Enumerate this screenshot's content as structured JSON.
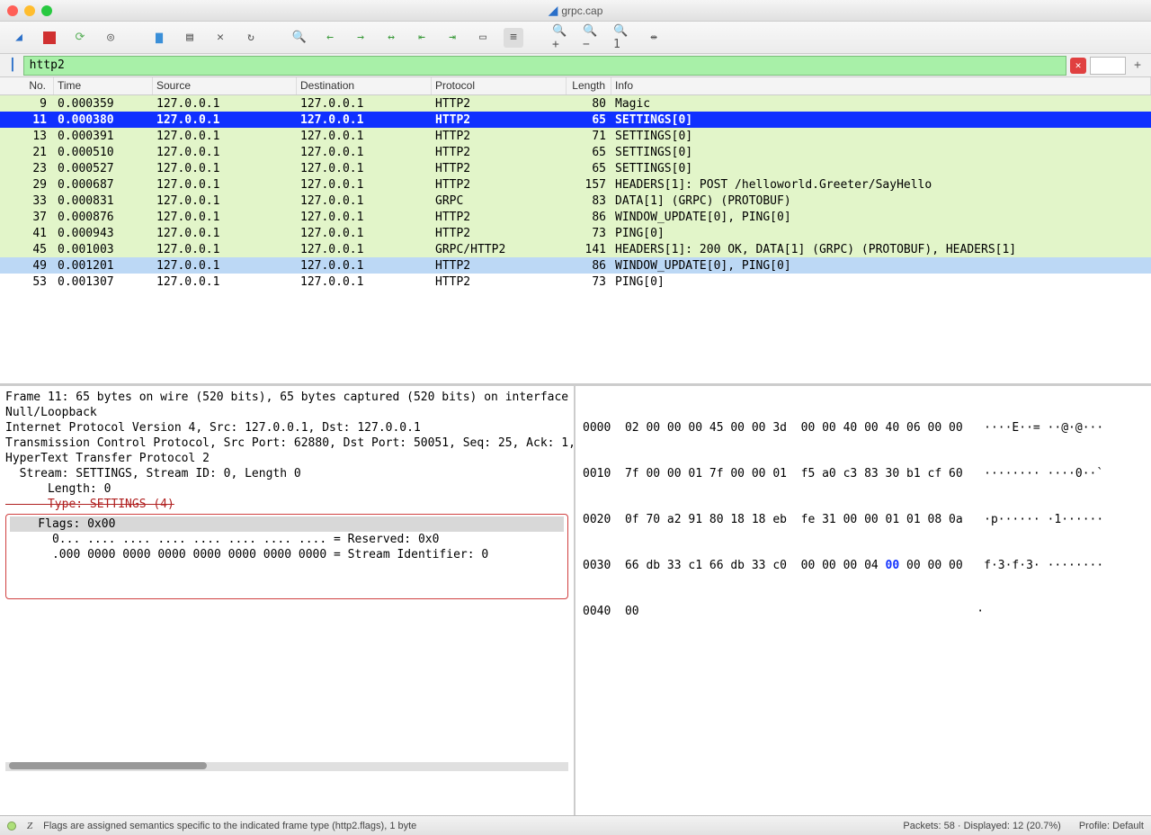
{
  "window": {
    "title": "grpc.cap"
  },
  "filter": {
    "value": "http2"
  },
  "columns": {
    "no": "No.",
    "time": "Time",
    "source": "Source",
    "destination": "Destination",
    "protocol": "Protocol",
    "length": "Length",
    "info": "Info"
  },
  "packets": [
    {
      "no": "9",
      "time": "0.000359",
      "src": "127.0.0.1",
      "dst": "127.0.0.1",
      "proto": "HTTP2",
      "len": "80",
      "info": "Magic",
      "cls": "green"
    },
    {
      "no": "11",
      "time": "0.000380",
      "src": "127.0.0.1",
      "dst": "127.0.0.1",
      "proto": "HTTP2",
      "len": "65",
      "info": "SETTINGS[0]",
      "cls": "selected-blue"
    },
    {
      "no": "13",
      "time": "0.000391",
      "src": "127.0.0.1",
      "dst": "127.0.0.1",
      "proto": "HTTP2",
      "len": "71",
      "info": "SETTINGS[0]",
      "cls": "green"
    },
    {
      "no": "21",
      "time": "0.000510",
      "src": "127.0.0.1",
      "dst": "127.0.0.1",
      "proto": "HTTP2",
      "len": "65",
      "info": "SETTINGS[0]",
      "cls": "green"
    },
    {
      "no": "23",
      "time": "0.000527",
      "src": "127.0.0.1",
      "dst": "127.0.0.1",
      "proto": "HTTP2",
      "len": "65",
      "info": "SETTINGS[0]",
      "cls": "green"
    },
    {
      "no": "29",
      "time": "0.000687",
      "src": "127.0.0.1",
      "dst": "127.0.0.1",
      "proto": "HTTP2",
      "len": "157",
      "info": "HEADERS[1]: POST /helloworld.Greeter/SayHello",
      "cls": "green"
    },
    {
      "no": "33",
      "time": "0.000831",
      "src": "127.0.0.1",
      "dst": "127.0.0.1",
      "proto": "GRPC",
      "len": "83",
      "info": "DATA[1] (GRPC) (PROTOBUF)",
      "cls": "green"
    },
    {
      "no": "37",
      "time": "0.000876",
      "src": "127.0.0.1",
      "dst": "127.0.0.1",
      "proto": "HTTP2",
      "len": "86",
      "info": "WINDOW_UPDATE[0], PING[0]",
      "cls": "green"
    },
    {
      "no": "41",
      "time": "0.000943",
      "src": "127.0.0.1",
      "dst": "127.0.0.1",
      "proto": "HTTP2",
      "len": "73",
      "info": "PING[0]",
      "cls": "green"
    },
    {
      "no": "45",
      "time": "0.001003",
      "src": "127.0.0.1",
      "dst": "127.0.0.1",
      "proto": "GRPC/HTTP2",
      "len": "141",
      "info": "HEADERS[1]: 200 OK, DATA[1] (GRPC) (PROTOBUF), HEADERS[1]",
      "cls": "green"
    },
    {
      "no": "49",
      "time": "0.001201",
      "src": "127.0.0.1",
      "dst": "127.0.0.1",
      "proto": "HTTP2",
      "len": "86",
      "info": "WINDOW_UPDATE[0], PING[0]",
      "cls": "selected-light"
    },
    {
      "no": "53",
      "time": "0.001307",
      "src": "127.0.0.1",
      "dst": "127.0.0.1",
      "proto": "HTTP2",
      "len": "73",
      "info": "PING[0]",
      "cls": ""
    }
  ],
  "detail": {
    "l0": "Frame 11: 65 bytes on wire (520 bits), 65 bytes captured (520 bits) on interface",
    "l1": "Null/Loopback",
    "l2": "Internet Protocol Version 4, Src: 127.0.0.1, Dst: 127.0.0.1",
    "l3": "Transmission Control Protocol, Src Port: 62880, Dst Port: 50051, Seq: 25, Ack: 1,",
    "l4": "HyperText Transfer Protocol 2",
    "l5": "  Stream: SETTINGS, Stream ID: 0, Length 0",
    "l6": "      Length: 0",
    "l7": "      Type: SETTINGS (4)",
    "l8": "    Flags: 0x00",
    "l9": "      0... .... .... .... .... .... .... .... = Reserved: 0x0",
    "l10": "      .000 0000 0000 0000 0000 0000 0000 0000 = Stream Identifier: 0"
  },
  "hex": {
    "r0": "0000  02 00 00 00 45 00 00 3d  00 00 40 00 40 06 00 00   ····E··= ··@·@···",
    "r1": "0010  7f 00 00 01 7f 00 00 01  f5 a0 c3 83 30 b1 cf 60   ········ ····0··`",
    "r2": "0020  0f 70 a2 91 80 18 18 eb  fe 31 00 00 01 01 08 0a   ·p······ ·1······",
    "r3a": "0030  66 db 33 c1 66 db 33 c0  00 00 00 04 ",
    "r3b": "00",
    "r3c": " 00 00 00   f·3·f·3· ········",
    "r4": "0040  00                                                ·"
  },
  "status": {
    "hint": "Flags are assigned semantics specific to the indicated frame type (http2.flags), 1 byte",
    "packets": "Packets: 58 · Displayed: 12 (20.7%)",
    "profile": "Profile: Default"
  }
}
